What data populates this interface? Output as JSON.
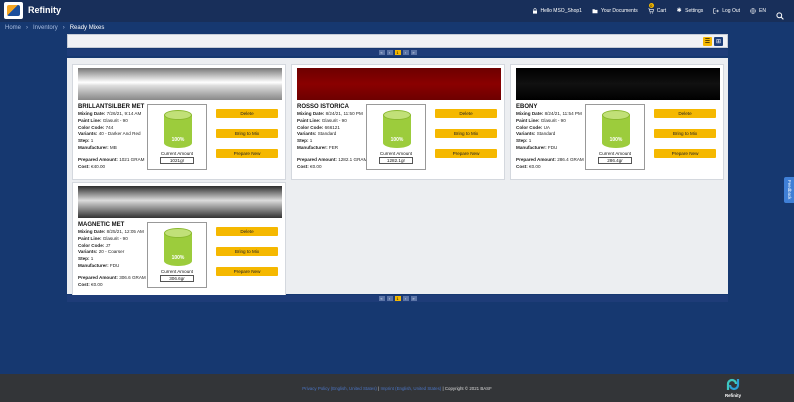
{
  "app": {
    "brand": "Refinity"
  },
  "topnav": {
    "user": "Hello MSO_Shop1",
    "documents": "Your Documents",
    "cart": "Cart",
    "cart_count": "0",
    "settings": "Settings",
    "logout": "Log Out",
    "language": "EN"
  },
  "breadcrumb": {
    "home": "Home",
    "inventory": "Inventory",
    "current": "Ready Mixes"
  },
  "pager": {
    "first": "«",
    "prev": "‹",
    "page": "1",
    "next": "›",
    "last": "»"
  },
  "labels": {
    "mixing_date": "Mixing Date:",
    "paint_line": "Paint Line:",
    "color_code": "Color Code:",
    "variants": "Variants:",
    "step": "Step:",
    "manufacturer": "Manufacturer:",
    "prepared_amount": "Prepared Amount:",
    "cost": "Cost:",
    "current_amount": "Current Amount",
    "delete": "Delete",
    "bring_to_mix": "Bring to Mix",
    "prepare_new": "Prepare New"
  },
  "mixes": [
    {
      "name": "BRILLANTSILBER MET",
      "mixing_date": "7/26/21, 9:14 AM",
      "paint_line": "Glasurit - 90",
      "color_code": "744",
      "variants": "40 - Darker And Red",
      "step": "1",
      "manufacturer": "MB",
      "prepared_amount": "1021 GRAM",
      "cost": "€40.00",
      "fill_percent": "100%",
      "current_amount": "1021gr",
      "swatch_color": "#9a9a9a"
    },
    {
      "name": "ROSSO ISTORICA",
      "mixing_date": "8/24/21, 11:50 PM",
      "paint_line": "Glasurit - 90",
      "color_code": "666121",
      "variants": "Standard",
      "step": "1",
      "manufacturer": "FER",
      "prepared_amount": "1282.1 GRAM",
      "cost": "€0.00",
      "fill_percent": "100%",
      "current_amount": "1282.1gr",
      "swatch_color": "#7a0000"
    },
    {
      "name": "EBONY",
      "mixing_date": "8/24/21, 11:54 PM",
      "paint_line": "Glasurit - 90",
      "color_code": "UA",
      "variants": "Standard",
      "step": "1",
      "manufacturer": "FDU",
      "prepared_amount": "286.4 GRAM",
      "cost": "€0.00",
      "fill_percent": "100%",
      "current_amount": "286.4gr",
      "swatch_color": "#050505"
    },
    {
      "name": "MAGNETIC MET",
      "mixing_date": "8/25/21, 12:05 AM",
      "paint_line": "Glasurit - 90",
      "color_code": "J7",
      "variants": "20 - Coarser",
      "step": "1",
      "manufacturer": "FDU",
      "prepared_amount": "306.6 GRAM",
      "cost": "€0.00",
      "fill_percent": "100%",
      "current_amount": "306.6gr",
      "swatch_color": "#4a4a4a"
    }
  ],
  "feedback": "Feedback",
  "footer": {
    "privacy": "Privacy Policy (English, United States)",
    "imprint": "Imprint (English, United States)",
    "separator": "|",
    "copyright": "Copyright © 2021 BASF",
    "logo_text": "Refinity"
  },
  "colors": {
    "accent": "#f5b800",
    "nav": "#1e3c78",
    "background": "#163870",
    "fill": "#9ccc3c"
  }
}
